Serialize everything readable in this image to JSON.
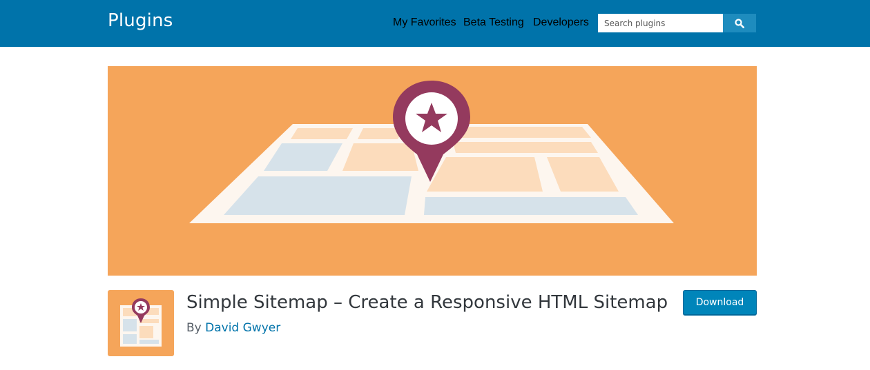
{
  "header": {
    "site_title": "Plugins",
    "nav": [
      {
        "label": "My Favorites"
      },
      {
        "label": "Beta Testing"
      },
      {
        "label": "Developers"
      }
    ],
    "search": {
      "placeholder": "Search plugins",
      "button_icon": "search-icon"
    }
  },
  "colors": {
    "header_bg": "#0073aa",
    "banner_bg": "#f5a55a",
    "pin": "#943a5e",
    "button": "#0085ba"
  },
  "plugin": {
    "title": "Simple Sitemap – Create a Responsive HTML Sitemap",
    "by_prefix": "By",
    "author": "David Gwyer",
    "download_label": "Download"
  }
}
